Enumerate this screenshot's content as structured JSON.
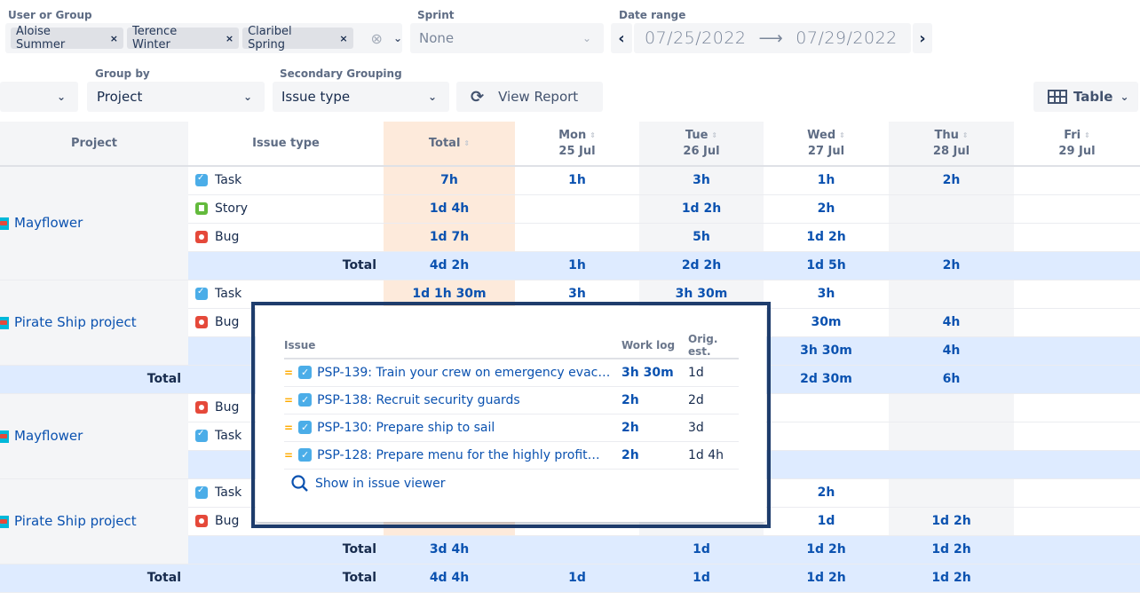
{
  "filters": {
    "user_group": {
      "label": "User or Group",
      "chips": [
        "Aloise Summer",
        "Terence Winter",
        "Claribel Spring"
      ],
      "chip_remove_glyph": "×",
      "clear_glyph": "⊗",
      "chevron_glyph": "⌄"
    },
    "sprint": {
      "label": "Sprint",
      "value": "None",
      "chevron_glyph": "⌄"
    },
    "date_range": {
      "label": "Date range",
      "prev_glyph": "‹",
      "next_glyph": "›",
      "from": "07/25/2022",
      "arrow": "⟶",
      "to": "07/29/2022"
    },
    "group_by": {
      "label": "Group by",
      "value": "Project"
    },
    "secondary_grouping": {
      "label": "Secondary Grouping",
      "value": "Issue type"
    },
    "view_report": {
      "label": "View Report",
      "icon": "refresh-icon"
    },
    "view_mode": {
      "label": "Table",
      "icon": "table-icon"
    }
  },
  "table": {
    "headers": {
      "project": "Project",
      "issue_type": "Issue type",
      "total": "Total",
      "days": [
        {
          "dow": "Mon",
          "date": "25 Jul"
        },
        {
          "dow": "Tue",
          "date": "26 Jul"
        },
        {
          "dow": "Wed",
          "date": "27 Jul"
        },
        {
          "dow": "Thu",
          "date": "28 Jul"
        },
        {
          "dow": "Fri",
          "date": "29 Jul"
        }
      ]
    },
    "total_label": "Total",
    "groups": [
      {
        "project": "Mayflower",
        "rows": [
          {
            "type": "Task",
            "icon": "task",
            "total": "7h",
            "days": [
              "1h",
              "3h",
              "1h",
              "2h",
              ""
            ]
          },
          {
            "type": "Story",
            "icon": "story",
            "total": "1d 4h",
            "days": [
              "",
              "1d 2h",
              "2h",
              "",
              ""
            ]
          },
          {
            "type": "Bug",
            "icon": "bug",
            "total": "1d 7h",
            "days": [
              "",
              "5h",
              "1d 2h",
              "",
              ""
            ]
          }
        ],
        "subtotal": {
          "total": "4d 2h",
          "days": [
            "1h",
            "2d 2h",
            "1d 5h",
            "2h",
            ""
          ]
        }
      },
      {
        "project": "Pirate Ship project",
        "rows": [
          {
            "type": "Task",
            "icon": "task",
            "total": "1d 1h 30m",
            "days": [
              "3h",
              "3h 30m",
              "3h",
              "",
              ""
            ]
          },
          {
            "type": "Bug",
            "icon": "bug",
            "total": "",
            "days": [
              "",
              "",
              "30m",
              "4h",
              ""
            ]
          }
        ],
        "subtotal": {
          "total": "",
          "days": [
            "",
            "",
            "3h 30m",
            "4h",
            ""
          ]
        }
      }
    ],
    "user_total_1": {
      "total": "",
      "days": [
        "",
        "",
        "2d 30m",
        "6h",
        ""
      ]
    },
    "groups2": [
      {
        "project": "Mayflower",
        "rows": [
          {
            "type": "Bug",
            "icon": "bug",
            "total": "",
            "days": [
              "",
              "",
              "",
              "",
              ""
            ]
          },
          {
            "type": "Task",
            "icon": "task",
            "total": "",
            "days": [
              "",
              "",
              "",
              "",
              ""
            ]
          }
        ],
        "subtotal": {
          "total": "",
          "days": [
            "",
            "",
            "",
            "",
            ""
          ]
        }
      },
      {
        "project": "Pirate Ship project",
        "rows": [
          {
            "type": "Task",
            "icon": "task",
            "total": "",
            "days": [
              "",
              "",
              "2h",
              "",
              ""
            ]
          },
          {
            "type": "Bug",
            "icon": "bug",
            "total": "",
            "days": [
              "",
              "",
              "1d",
              "1d 2h",
              ""
            ]
          }
        ],
        "subtotal": {
          "total": "3d 4h",
          "days": [
            "",
            "1d",
            "1d 2h",
            "1d 2h",
            ""
          ]
        }
      }
    ],
    "user_total_2": {
      "total": "4d 4h",
      "days": [
        "1d",
        "1d",
        "1d 2h",
        "1d 2h",
        ""
      ]
    }
  },
  "popup": {
    "headers": {
      "issue": "Issue",
      "work_log": "Work log",
      "orig_est": "Orig. est."
    },
    "issues": [
      {
        "key_summary": "PSP-139: Train your crew on emergency evac…",
        "work_log": "3h 30m",
        "orig_est": "1d"
      },
      {
        "key_summary": "PSP-138: Recruit security guards",
        "work_log": "2h",
        "orig_est": "2d"
      },
      {
        "key_summary": "PSP-130: Prepare ship to sail",
        "work_log": "2h",
        "orig_est": "3d"
      },
      {
        "key_summary": "PSP-128: Prepare menu for the highly profit…",
        "work_log": "2h",
        "orig_est": "1d 4h"
      }
    ],
    "show_in_viewer": "Show in issue viewer"
  }
}
